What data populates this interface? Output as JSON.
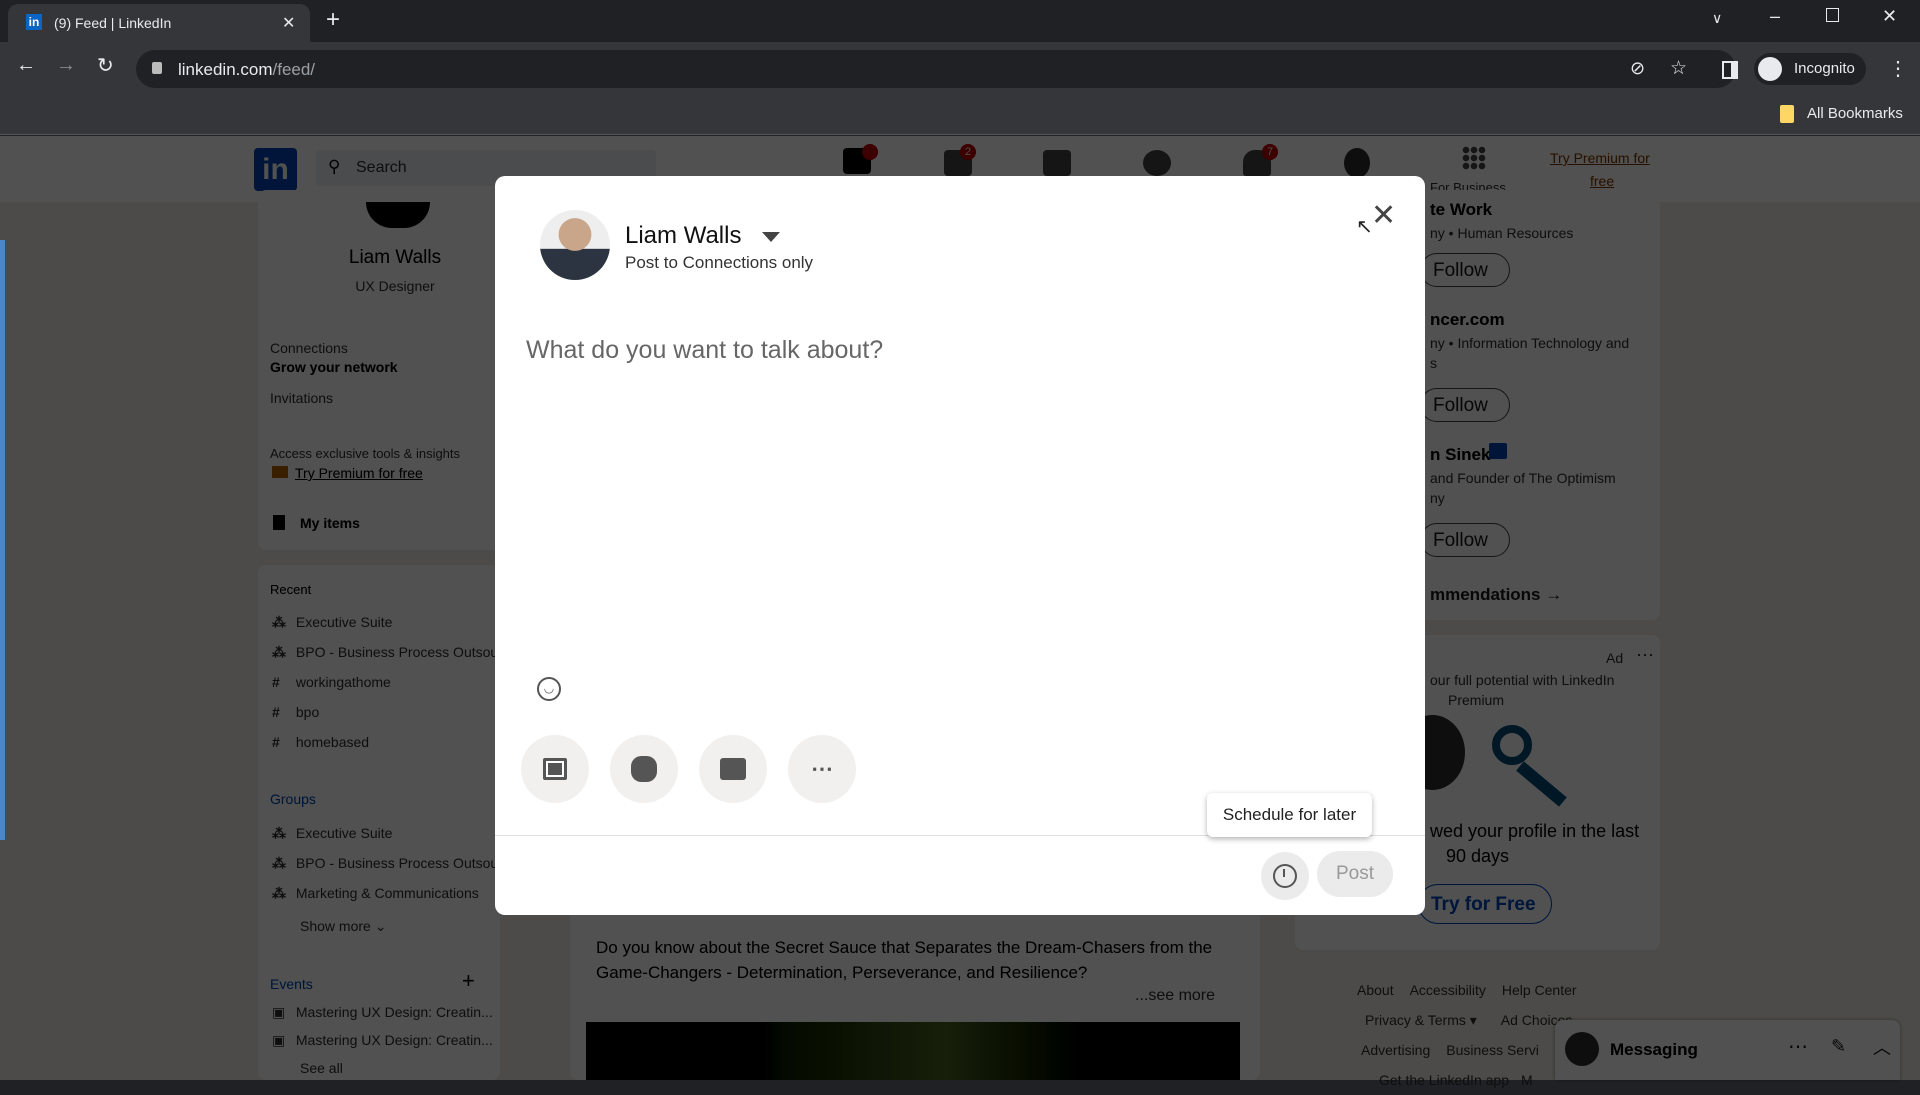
{
  "browser": {
    "tab_title": "(9) Feed | LinkedIn",
    "url_host": "linkedin.com",
    "url_path": "/feed/",
    "profile": "Incognito",
    "bookmarks": "All Bookmarks"
  },
  "header": {
    "search_placeholder": "Search",
    "badges": {
      "home": "",
      "network": "2",
      "notifications": "7"
    },
    "for_business": "For Business",
    "premium_line1": "Try Premium for",
    "premium_line2": "free"
  },
  "left": {
    "name": "Liam Walls",
    "title": "UX Designer",
    "connections": "Connections",
    "grow": "Grow your network",
    "invitations": "Invitations",
    "access": "Access exclusive tools & insights",
    "try_premium": "Try Premium for free",
    "my_items": "My items",
    "recent_label": "Recent",
    "recent": [
      {
        "icon": "group",
        "label": "Executive Suite"
      },
      {
        "icon": "group",
        "label": "BPO - Business Process Outsourcing"
      },
      {
        "icon": "hashtag",
        "label": "workingathome"
      },
      {
        "icon": "hashtag",
        "label": "bpo"
      },
      {
        "icon": "hashtag",
        "label": "homebased"
      }
    ],
    "groups_label": "Groups",
    "groups": [
      "Executive Suite",
      "BPO - Business Process Outsourcing",
      "Marketing & Communications"
    ],
    "show_more": "Show more",
    "events_label": "Events",
    "events": [
      "Mastering UX Design: Creatin...",
      "Mastering UX Design: Creatin..."
    ],
    "see_all": "See all"
  },
  "feed": {
    "post_text": "Do you know about the Secret Sauce that Separates the Dream-Chasers from the Game-Changers - Determination, Perseverance, and Resilience?",
    "see_more": "...see more"
  },
  "right": {
    "items": [
      {
        "name": "te Work",
        "sub": "ny • Human Resources"
      },
      {
        "name": "ncer.com",
        "sub": "ny • Information Technology and",
        "sub2": "s"
      },
      {
        "name": "n Sinek",
        "sub": "and Founder of The Optimism",
        "sub2": "ny"
      }
    ],
    "follow": "Follow",
    "recommendations": "mmendations →",
    "ad": "Ad",
    "ad_text1": "our full potential with LinkedIn",
    "ad_text2": "Premium",
    "ad_text3": "wed your profile in the last",
    "ad_text4": "90 days",
    "try_free": "Try for Free",
    "footer": [
      "About",
      "Accessibility",
      "Help Center",
      "Privacy & Terms ▾",
      "Ad Choices",
      "Advertising",
      "Business Servi",
      "Get the LinkedIn app",
      "M"
    ],
    "messaging": "Messaging"
  },
  "modal": {
    "author": "Liam Walls",
    "audience": "Post to Connections only",
    "placeholder": "What do you want to talk about?",
    "tooltip": "Schedule for later",
    "post": "Post"
  },
  "colors": {
    "brand": "#0a66c2",
    "badge": "#cc1016"
  }
}
